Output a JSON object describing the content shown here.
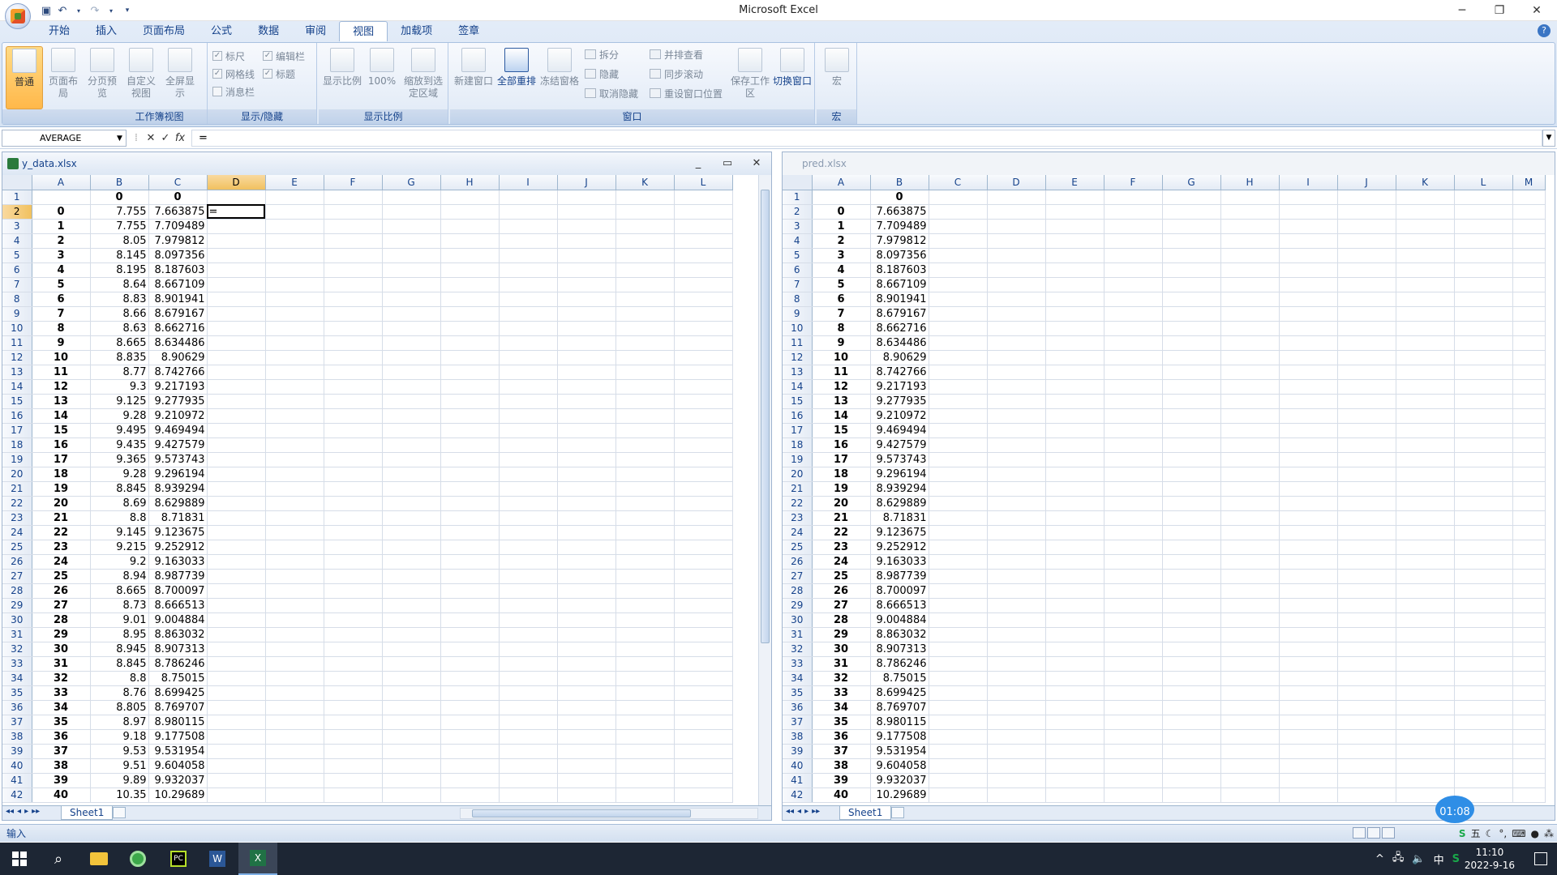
{
  "app": {
    "title": "Microsoft Excel"
  },
  "quick_access": [
    "save",
    "undo",
    "redo",
    "customize"
  ],
  "tabs": [
    "开始",
    "插入",
    "页面布局",
    "公式",
    "数据",
    "审阅",
    "视图",
    "加载项",
    "签章"
  ],
  "active_tab": "视图",
  "ribbon": {
    "workbook_views": {
      "label": "工作簿视图",
      "buttons": [
        "普通",
        "页面布局",
        "分页预览",
        "自定义视图",
        "全屏显示"
      ]
    },
    "show_hide": {
      "label": "显示/隐藏",
      "items": [
        {
          "label": "标尺",
          "checked": true
        },
        {
          "label": "编辑栏",
          "checked": true
        },
        {
          "label": "网格线",
          "checked": true
        },
        {
          "label": "标题",
          "checked": true
        },
        {
          "label": "消息栏",
          "checked": false
        }
      ]
    },
    "zoom": {
      "label": "显示比例",
      "buttons": [
        "显示比例",
        "100%",
        "缩放到选定区域"
      ]
    },
    "window": {
      "label": "窗口",
      "buttons": [
        "新建窗口",
        "全部重排",
        "冻结窗格"
      ],
      "small": [
        "拆分",
        "隐藏",
        "取消隐藏",
        "并排查看",
        "同步滚动",
        "重设窗口位置"
      ],
      "save_ws": "保存工作区",
      "switch": "切换窗口"
    },
    "macro": {
      "label": "宏",
      "button": "宏"
    }
  },
  "formula_bar": {
    "name_box": "AVERAGE",
    "formula": "="
  },
  "left_wb": {
    "title": "y_data.xlsx",
    "columns": [
      "A",
      "B",
      "C",
      "D",
      "E",
      "F",
      "G",
      "H",
      "I",
      "J",
      "K",
      "L"
    ],
    "header_row": [
      "",
      "0",
      "0"
    ],
    "active_cell_text": "=",
    "sheet": "Sheet1",
    "rows": [
      [
        "0",
        "7.755",
        "7.663875"
      ],
      [
        "1",
        "7.755",
        "7.709489"
      ],
      [
        "2",
        "8.05",
        "7.979812"
      ],
      [
        "3",
        "8.145",
        "8.097356"
      ],
      [
        "4",
        "8.195",
        "8.187603"
      ],
      [
        "5",
        "8.64",
        "8.667109"
      ],
      [
        "6",
        "8.83",
        "8.901941"
      ],
      [
        "7",
        "8.66",
        "8.679167"
      ],
      [
        "8",
        "8.63",
        "8.662716"
      ],
      [
        "9",
        "8.665",
        "8.634486"
      ],
      [
        "10",
        "8.835",
        "8.90629"
      ],
      [
        "11",
        "8.77",
        "8.742766"
      ],
      [
        "12",
        "9.3",
        "9.217193"
      ],
      [
        "13",
        "9.125",
        "9.277935"
      ],
      [
        "14",
        "9.28",
        "9.210972"
      ],
      [
        "15",
        "9.495",
        "9.469494"
      ],
      [
        "16",
        "9.435",
        "9.427579"
      ],
      [
        "17",
        "9.365",
        "9.573743"
      ],
      [
        "18",
        "9.28",
        "9.296194"
      ],
      [
        "19",
        "8.845",
        "8.939294"
      ],
      [
        "20",
        "8.69",
        "8.629889"
      ],
      [
        "21",
        "8.8",
        "8.71831"
      ],
      [
        "22",
        "9.145",
        "9.123675"
      ],
      [
        "23",
        "9.215",
        "9.252912"
      ],
      [
        "24",
        "9.2",
        "9.163033"
      ],
      [
        "25",
        "8.94",
        "8.987739"
      ],
      [
        "26",
        "8.665",
        "8.700097"
      ],
      [
        "27",
        "8.73",
        "8.666513"
      ],
      [
        "28",
        "9.01",
        "9.004884"
      ],
      [
        "29",
        "8.95",
        "8.863032"
      ],
      [
        "30",
        "8.945",
        "8.907313"
      ],
      [
        "31",
        "8.845",
        "8.786246"
      ],
      [
        "32",
        "8.8",
        "8.75015"
      ],
      [
        "33",
        "8.76",
        "8.699425"
      ],
      [
        "34",
        "8.805",
        "8.769707"
      ],
      [
        "35",
        "8.97",
        "8.980115"
      ],
      [
        "36",
        "9.18",
        "9.177508"
      ],
      [
        "37",
        "9.53",
        "9.531954"
      ],
      [
        "38",
        "9.51",
        "9.604058"
      ],
      [
        "39",
        "9.89",
        "9.932037"
      ],
      [
        "40",
        "10.35",
        "10.29689"
      ]
    ]
  },
  "right_wb": {
    "title": "pred.xlsx",
    "columns": [
      "A",
      "B",
      "C",
      "D",
      "E",
      "F",
      "G",
      "H",
      "I",
      "J",
      "K",
      "L",
      "M"
    ],
    "header_row": [
      "",
      "0"
    ],
    "sheet": "Sheet1",
    "rows": [
      [
        "0",
        "7.663875"
      ],
      [
        "1",
        "7.709489"
      ],
      [
        "2",
        "7.979812"
      ],
      [
        "3",
        "8.097356"
      ],
      [
        "4",
        "8.187603"
      ],
      [
        "5",
        "8.667109"
      ],
      [
        "6",
        "8.901941"
      ],
      [
        "7",
        "8.679167"
      ],
      [
        "8",
        "8.662716"
      ],
      [
        "9",
        "8.634486"
      ],
      [
        "10",
        "8.90629"
      ],
      [
        "11",
        "8.742766"
      ],
      [
        "12",
        "9.217193"
      ],
      [
        "13",
        "9.277935"
      ],
      [
        "14",
        "9.210972"
      ],
      [
        "15",
        "9.469494"
      ],
      [
        "16",
        "9.427579"
      ],
      [
        "17",
        "9.573743"
      ],
      [
        "18",
        "9.296194"
      ],
      [
        "19",
        "8.939294"
      ],
      [
        "20",
        "8.629889"
      ],
      [
        "21",
        "8.71831"
      ],
      [
        "22",
        "9.123675"
      ],
      [
        "23",
        "9.252912"
      ],
      [
        "24",
        "9.163033"
      ],
      [
        "25",
        "8.987739"
      ],
      [
        "26",
        "8.700097"
      ],
      [
        "27",
        "8.666513"
      ],
      [
        "28",
        "9.004884"
      ],
      [
        "29",
        "8.863032"
      ],
      [
        "30",
        "8.907313"
      ],
      [
        "31",
        "8.786246"
      ],
      [
        "32",
        "8.75015"
      ],
      [
        "33",
        "8.699425"
      ],
      [
        "34",
        "8.769707"
      ],
      [
        "35",
        "8.980115"
      ],
      [
        "36",
        "9.177508"
      ],
      [
        "37",
        "9.531954"
      ],
      [
        "38",
        "9.604058"
      ],
      [
        "39",
        "9.932037"
      ],
      [
        "40",
        "10.29689"
      ]
    ]
  },
  "status": {
    "mode": "输入",
    "timer": "01:08"
  },
  "ime": [
    "五",
    "中"
  ],
  "taskbar": {
    "time": "11:10",
    "date": "2022-9-16",
    "lang": "中"
  }
}
